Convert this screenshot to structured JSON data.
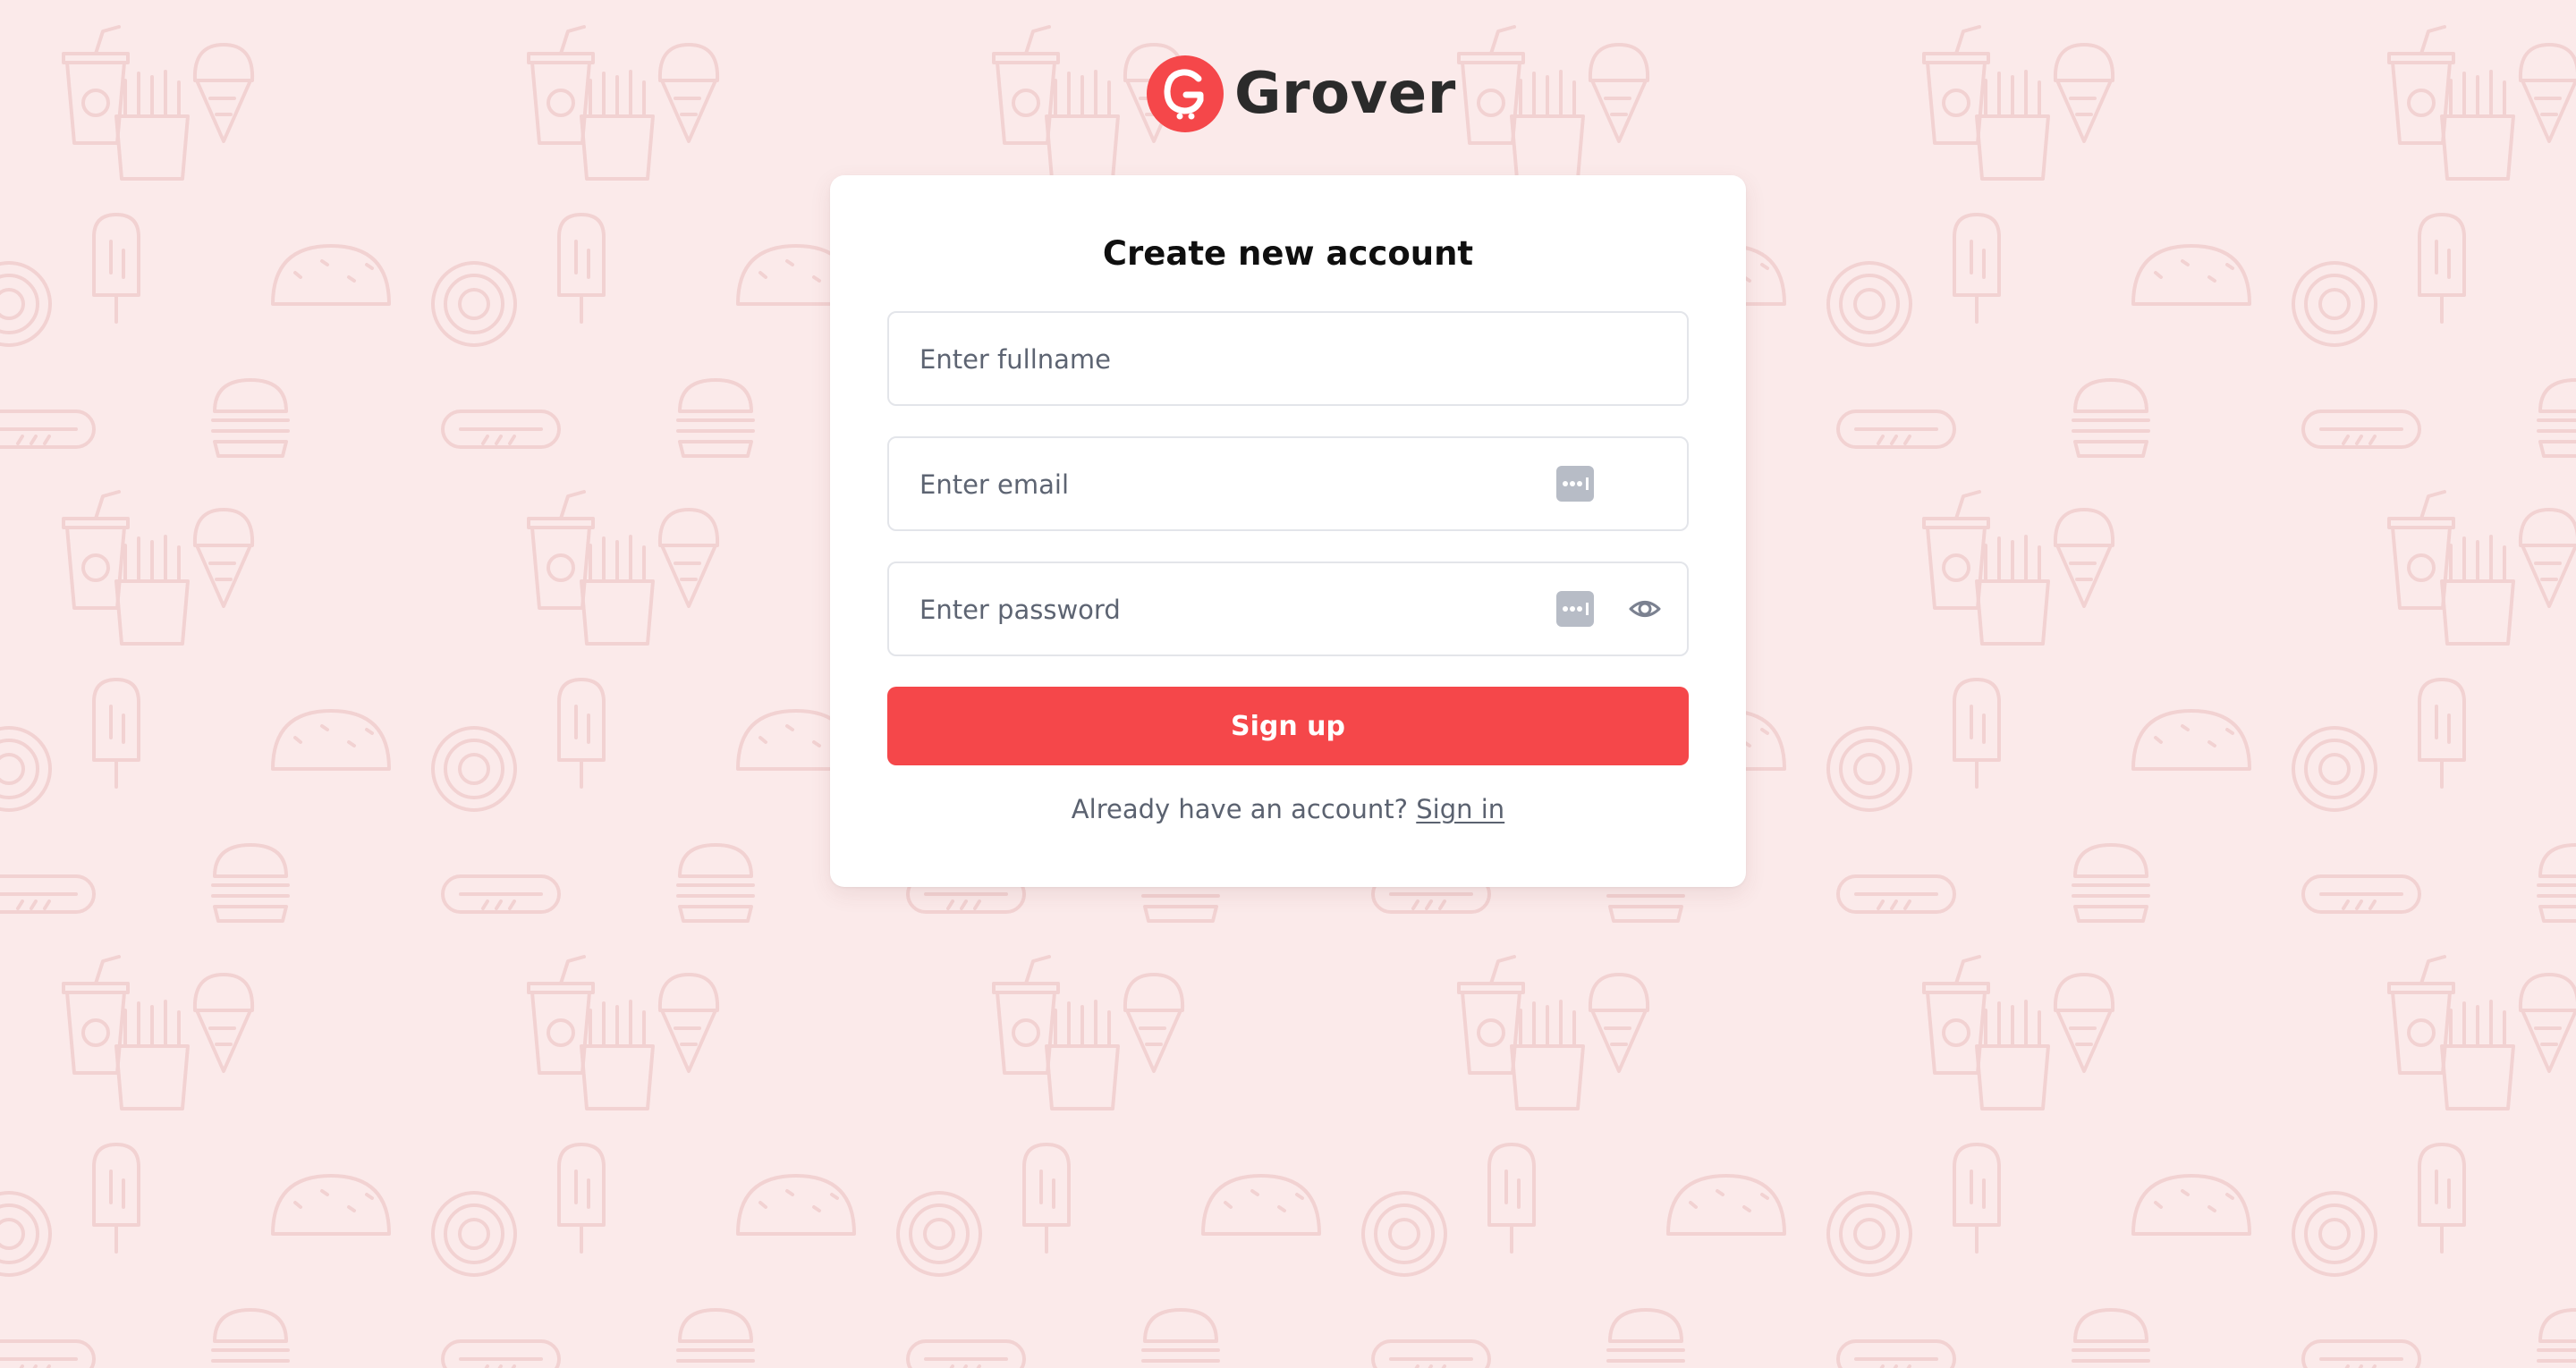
{
  "brand": {
    "name": "Grover",
    "logo_letter": "G",
    "logo_color": "#f5474a"
  },
  "colors": {
    "background": "#fbeaea",
    "pattern_stroke": "#f2d2d2",
    "accent": "#f5474a",
    "card": "#ffffff"
  },
  "signup": {
    "title": "Create new account",
    "fullname_placeholder": "Enter fullname",
    "email_placeholder": "Enter email",
    "password_placeholder": "Enter password",
    "submit_label": "Sign up",
    "have_account_text": "Already have an account?",
    "signin_link": "Sign in"
  },
  "icons": {
    "email_field": "password-manager-key-icon",
    "password_field": [
      "password-manager-key-icon",
      "eye-icon"
    ],
    "background_pattern": [
      "soda-cup-icon",
      "ice-cream-icon",
      "fries-icon",
      "taco-icon",
      "popsicle-icon",
      "donut-icon",
      "hotdog-icon",
      "burger-icon"
    ]
  }
}
